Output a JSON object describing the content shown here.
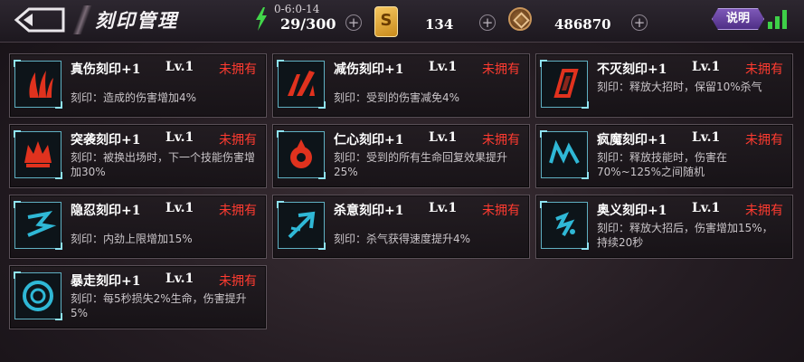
{
  "header": {
    "title": "刻印管理",
    "energy": {
      "timer": "0-6:0-14",
      "value": "29/300"
    },
    "card": {
      "symbol": "S",
      "value": "134"
    },
    "coin": {
      "value": "486870"
    },
    "help_label": "说明",
    "plus_symbol": "+"
  },
  "colors": {
    "status_red": "#ff3b30",
    "icon_red": "#e0321e",
    "icon_blue": "#2fb8d6"
  },
  "imprints": [
    {
      "name": "真伤刻印+1",
      "level": "Lv.1",
      "status": "未拥有",
      "desc": "刻印：造成的伤害增加4%",
      "icon": "claw-red-icon"
    },
    {
      "name": "减伤刻印+1",
      "level": "Lv.1",
      "status": "未拥有",
      "desc": "刻印：受到的伤害减免4%",
      "icon": "slash-red-icon"
    },
    {
      "name": "不灭刻印+1",
      "level": "Lv.1",
      "status": "未拥有",
      "desc": "刻印：释放大招时，保留10%杀气",
      "icon": "card-red-icon"
    },
    {
      "name": "突袭刻印+1",
      "level": "Lv.1",
      "status": "未拥有",
      "desc": "刻印：被换出场时，下一个技能伤害增加30%",
      "icon": "crown-red-icon"
    },
    {
      "name": "仁心刻印+1",
      "level": "Lv.1",
      "status": "未拥有",
      "desc": "刻印：受到的所有生命回复效果提升25%",
      "icon": "heart-red-icon"
    },
    {
      "name": "疯魔刻印+1",
      "level": "Lv.1",
      "status": "未拥有",
      "desc": "刻印：释放技能时，伤害在70%~125%之间随机",
      "icon": "zigzag-blue-icon"
    },
    {
      "name": "隐忍刻印+1",
      "level": "Lv.1",
      "status": "未拥有",
      "desc": "刻印：内劲上限增加15%",
      "icon": "glyph-blue-icon"
    },
    {
      "name": "杀意刻印+1",
      "level": "Lv.1",
      "status": "未拥有",
      "desc": "刻印：杀气获得速度提升4%",
      "icon": "arrow-blue-icon"
    },
    {
      "name": "奥义刻印+1",
      "level": "Lv.1",
      "status": "未拥有",
      "desc": "刻印：释放大招后，伤害增加15%，持续20秒",
      "icon": "rune-blue-icon"
    },
    {
      "name": "暴走刻印+1",
      "level": "Lv.1",
      "status": "未拥有",
      "desc": "刻印：每5秒损失2%生命，伤害提升5%",
      "icon": "ring-blue-icon"
    }
  ]
}
